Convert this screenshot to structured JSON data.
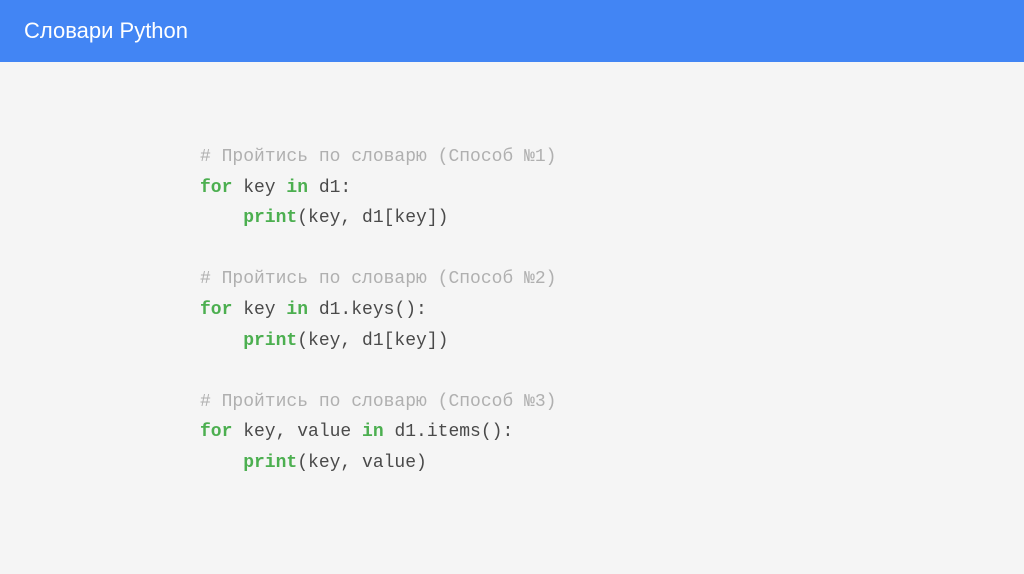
{
  "header": {
    "title": "Словари Python"
  },
  "code": {
    "block1": {
      "comment": "# Пройтись по словарю (Способ №1)",
      "line1_kw1": "for",
      "line1_mid": " key ",
      "line1_kw2": "in",
      "line1_end": " d1:",
      "line2_fn": "print",
      "line2_args": "(key, d1[key])"
    },
    "block2": {
      "comment": "# Пройтись по словарю (Способ №2)",
      "line1_kw1": "for",
      "line1_mid": " key ",
      "line1_kw2": "in",
      "line1_end": " d1.keys():",
      "line2_fn": "print",
      "line2_args": "(key, d1[key])"
    },
    "block3": {
      "comment": "# Пройтись по словарю (Способ №3)",
      "line1_kw1": "for",
      "line1_mid": " key, value ",
      "line1_kw2": "in",
      "line1_end": " d1.items():",
      "line2_fn": "print",
      "line2_args": "(key, value)"
    }
  }
}
